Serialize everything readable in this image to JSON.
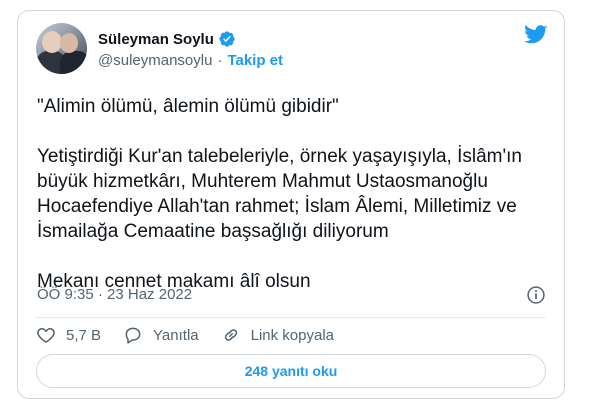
{
  "author": {
    "name": "Süleyman Soylu",
    "handle": "@suleymansoylu",
    "separator": "·",
    "follow_label": "Takip et"
  },
  "tweet": {
    "paragraphs": [
      "\"Alimin ölümü, âlemin ölümü gibidir\"",
      "Yetiştirdiği Kur'an talebeleriyle, örnek yaşayışıyla, İslâm'ın büyük hizmetkârı, Muhterem Mahmut Ustaosmanoğlu Hocaefendiye Allah'tan rahmet; İslam Âlemi, Milletimiz ve İsmailağa Cemaatine başsağlığı diliyorum",
      "Mekanı cennet makamı âlî olsun"
    ],
    "timestamp": "ÖÖ 9:35 · 23 Haz 2022"
  },
  "actions": {
    "likes": "5,7 B",
    "reply_label": "Yanıtla",
    "copy_link_label": "Link kopyala",
    "read_replies_label": "248 yanıtı oku"
  },
  "colors": {
    "accent": "#1d9bf0",
    "text": "#0f1419",
    "muted": "#536471",
    "border": "#d0d7dd"
  },
  "icons": [
    "verified-badge-icon",
    "twitter-bird-icon",
    "info-icon",
    "heart-icon",
    "reply-icon",
    "link-icon"
  ]
}
